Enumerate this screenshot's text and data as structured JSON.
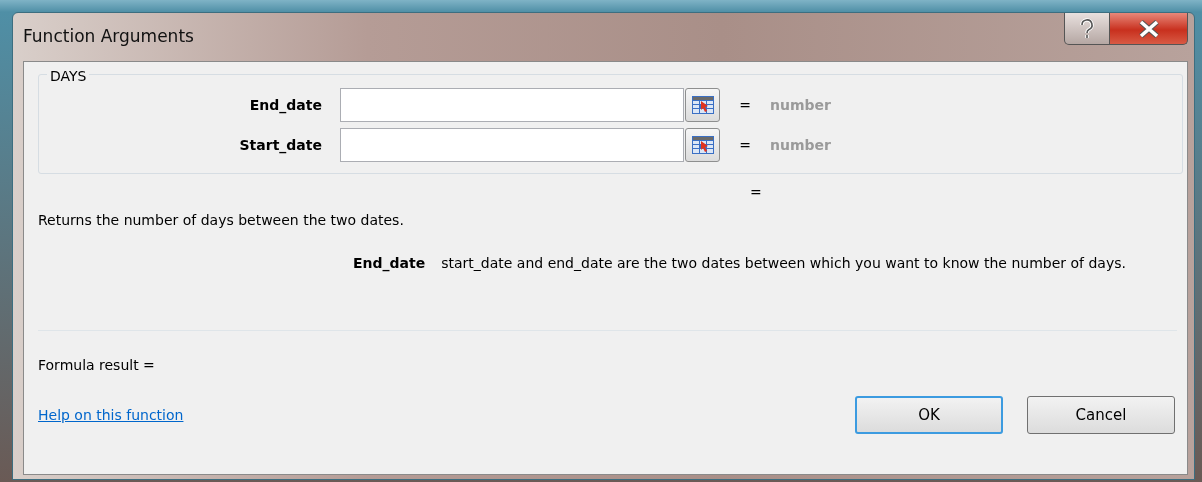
{
  "window": {
    "title": "Function Arguments"
  },
  "function_name": "DAYS",
  "arguments": [
    {
      "name": "End_date",
      "equals": "=",
      "result": "number"
    },
    {
      "name": "Start_date",
      "equals": "=",
      "result": "number"
    }
  ],
  "result_equals": "=",
  "description": "Returns the number of days between the two dates.",
  "argument_help": {
    "name": "End_date",
    "text": "start_date and end_date are the two dates between which you want to know the number of days."
  },
  "formula_result": "Formula result =",
  "help_link": "Help on this function",
  "buttons": [
    {
      "label": "OK",
      "default": true
    },
    {
      "label": "Cancel",
      "default": false
    }
  ]
}
